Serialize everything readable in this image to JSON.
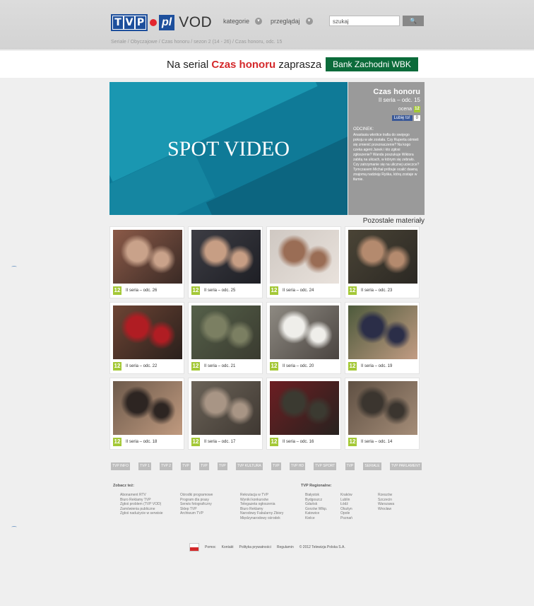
{
  "header": {
    "logo_tvp": [
      "T",
      "V",
      "P"
    ],
    "logo_pl": "pl",
    "logo_vod": "VOD",
    "nav": [
      "kategorie",
      "przeglądaj"
    ],
    "search_placeholder": "szukaj",
    "search_button": "🔍"
  },
  "breadcrumb": "Seriale / Obyczajowe / Czas honoru / sezon 2 (14 - 26) / Czas honoru, odc. 15",
  "sponsor": {
    "prefix": "Na serial",
    "highlight": "Czas honoru",
    "suffix": "zaprasza",
    "bank": "Bank Zachodni WBK"
  },
  "player": {
    "label": "SPOT VIDEO"
  },
  "info": {
    "title": "Czas honoru",
    "episode": "II seria – odc. 15",
    "rating_label": "ocena",
    "age": "12",
    "like_label": "Lubię to!",
    "like_count": "0",
    "desc_label": "ODCINEK:",
    "description": "Anastasia wkrótce trafia do swojego pokoju w ale została. Czy Ruperta ośmieli się zmienić przeznaczenie? Na kogo czeka agent Janek i kto zgłosi zgłoszenie? Wanda poszukuje Wiktora zabitą na ulicach, w którym się zebrało. Czy zatrzymanie się na ulicznej ucieczce? Tymczasem Michał próbuje ocalić dawną znajomą nadzieję Ryśka, którą zostaje w tłumie."
  },
  "others_label": "Pozostałe materiały",
  "cards": [
    {
      "age": "12",
      "caption": "II seria – odc. 26",
      "colors": [
        "#8b5a48",
        "#c9a28a",
        "#3a2a25"
      ]
    },
    {
      "age": "12",
      "caption": "II seria – odc. 25",
      "colors": [
        "#3d3d44",
        "#c79e84",
        "#1e1f25"
      ]
    },
    {
      "age": "12",
      "caption": "II seria – odc. 24",
      "colors": [
        "#cfc8c2",
        "#9a6d55",
        "#e9e2dc"
      ]
    },
    {
      "age": "12",
      "caption": "II seria – odc. 23",
      "colors": [
        "#4a4436",
        "#b48a6e",
        "#2b2823"
      ]
    },
    {
      "age": "12",
      "caption": "II seria – odc. 22",
      "colors": [
        "#6d4434",
        "#b01d23",
        "#2a201c"
      ]
    },
    {
      "age": "12",
      "caption": "II seria – odc. 21",
      "colors": [
        "#556049",
        "#7b7f62",
        "#3a3b30"
      ]
    },
    {
      "age": "12",
      "caption": "II seria – odc. 20",
      "colors": [
        "#8e8a82",
        "#efeeea",
        "#4a4440"
      ]
    },
    {
      "age": "12",
      "caption": "II seria – odc. 19",
      "colors": [
        "#4d5a3c",
        "#2b2e48",
        "#c29c83"
      ]
    },
    {
      "age": "12",
      "caption": "II seria – odc. 18",
      "colors": [
        "#6d5a4b",
        "#2d2522",
        "#c09a7f"
      ]
    },
    {
      "age": "12",
      "caption": "II seria – odc. 17",
      "colors": [
        "#6b6358",
        "#a89585",
        "#3f3832"
      ]
    },
    {
      "age": "12",
      "caption": "II seria – odc. 16",
      "colors": [
        "#6c1e22",
        "#3b3a31",
        "#27221f"
      ]
    },
    {
      "age": "12",
      "caption": "II seria – odc. 14",
      "colors": [
        "#5f5043",
        "#3b352f",
        "#a58d78"
      ]
    }
  ],
  "channels": [
    "TVP INFO",
    "TVP 1",
    "TVP 2",
    "TVP",
    "TVP",
    "TVP",
    "TVP KULTURA",
    "TVP",
    "TVP HD",
    "TVP SPORT",
    "TVP",
    "SERIALE",
    "TVP PARLAMENT"
  ],
  "footer": {
    "see_also": "Zobacz też:",
    "regional": "TVP Regionalne:",
    "col1": [
      "Abonament RTV",
      "Biuro Reklamy TVP",
      "Zgłoś problem (TVP VOD)",
      "Zamówienia publiczne",
      "Zgłoś nadużycie w serwisie"
    ],
    "col2": [
      "Ośrodki programowe",
      "Program dla prasy",
      "Serwis fotograficzny",
      "Sklep TVP",
      "Archiwum TVP"
    ],
    "col3": [
      "Rekrutacja w TVP",
      "Wyniki konkursów",
      "Telegazeta ogłoszenia",
      "Biuro Reklamy",
      "Narodowy Fabularny Zbiory",
      "Międzynarodowy ośrodek"
    ],
    "col4": [
      "Białystok",
      "Bydgoszcz",
      "Gdańsk",
      "Gorzów Wlkp.",
      "Katowice",
      "Kielce"
    ],
    "col5": [
      "Kraków",
      "Lublin",
      "Łódź",
      "Olsztyn",
      "Opole",
      "Poznań"
    ],
    "col6": [
      "Rzeszów",
      "Szczecin",
      "Warszawa",
      "Wrocław"
    ]
  },
  "bottom_links": [
    "Pomoc",
    "Kontakt",
    "Polityka prywatności",
    "Regulamin",
    "© 2012 Telewizja Polska S.A."
  ]
}
